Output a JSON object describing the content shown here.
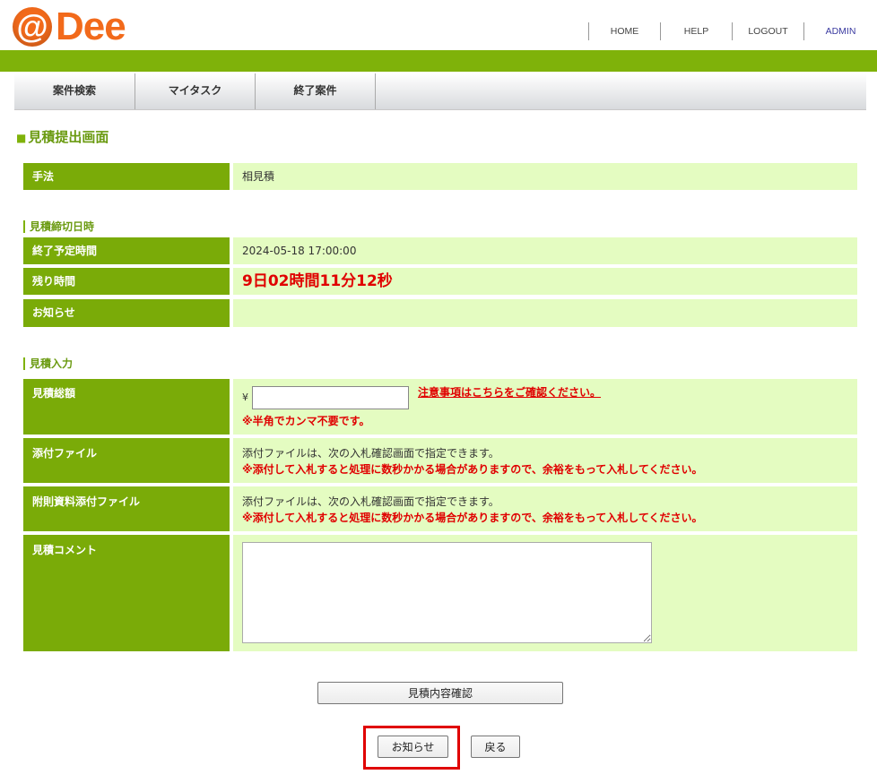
{
  "logo": {
    "at": "@",
    "name": "Dee"
  },
  "topnav": {
    "home": "HOME",
    "help": "HELP",
    "logout": "LOGOUT",
    "admin": "ADMIN"
  },
  "menu": [
    "案件検索",
    "マイタスク",
    "終了案件"
  ],
  "page_title": "見積提出画面",
  "method": {
    "label": "手法",
    "value": "相見積"
  },
  "deadline_section": {
    "title": "見積締切日時",
    "end_time_label": "終了予定時間",
    "end_time_value": "2024-05-18 17:00:00",
    "remaining_label": "残り時間",
    "remaining_value": "9日02時間11分12秒",
    "notice_label": "お知らせ",
    "notice_value": ""
  },
  "input_section": {
    "title": "見積入力",
    "total_label": "見積総額",
    "yen": "¥",
    "total_value": "",
    "notice_link": "注意事項はこちらをご確認ください。",
    "half_width_note": "※半角でカンマ不要です。",
    "attach_label": "添付ファイル",
    "attach_text": "添付ファイルは、次の入札確認画面で指定できます。",
    "attach_warning": "※添付して入札すると処理に数秒かかる場合がありますので、余裕をもって入札してください。",
    "appendix_label": "附則資料添付ファイル",
    "appendix_text": "添付ファイルは、次の入札確認画面で指定できます。",
    "appendix_warning": "※添付して入札すると処理に数秒かかる場合がありますので、余裕をもって入札してください。",
    "comment_label": "見積コメント",
    "comment_value": ""
  },
  "buttons": {
    "confirm": "見積内容確認",
    "notice": "お知らせ",
    "back": "戻る"
  },
  "colors": {
    "brand_orange": "#f26a1b",
    "green": "#7fb20a",
    "light_green": "#e4fcc1",
    "red": "#e00000"
  }
}
